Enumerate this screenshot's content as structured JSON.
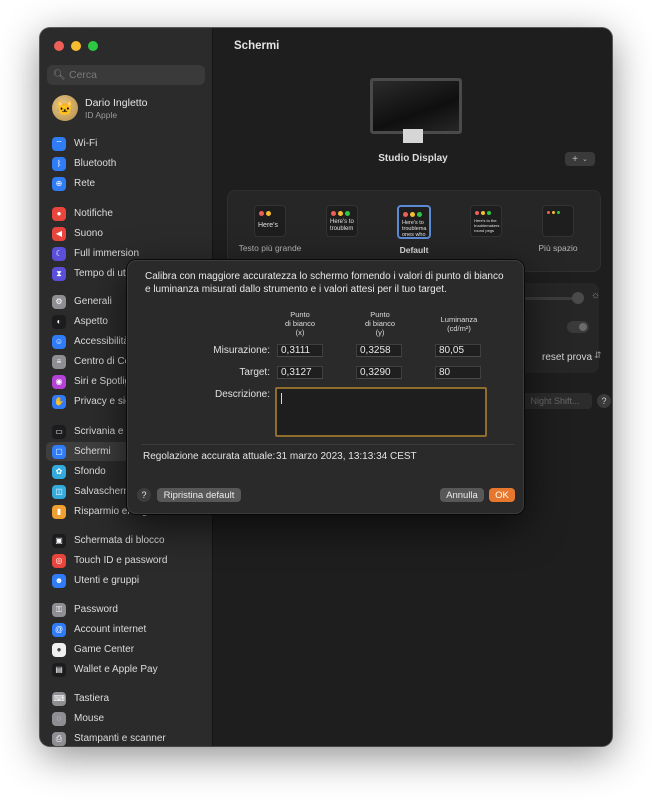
{
  "window": {
    "title": "Schermi",
    "traffic_colors": [
      "#ee5f57",
      "#f6bd2f",
      "#2dc842"
    ]
  },
  "sidebar": {
    "search_placeholder": "Cerca",
    "account": {
      "name": "Dario Ingletto",
      "subtitle": "ID Apple"
    },
    "items": [
      {
        "label": "Wi-Fi",
        "icon": "wifi-icon",
        "color": "#2f7cf6"
      },
      {
        "label": "Bluetooth",
        "icon": "bluetooth-icon",
        "color": "#2f7cf6"
      },
      {
        "label": "Rete",
        "icon": "globe-icon",
        "color": "#2f7cf6"
      },
      {
        "label": "Notifiche",
        "icon": "bell-icon",
        "color": "#e8453c"
      },
      {
        "label": "Suono",
        "icon": "speaker-icon",
        "color": "#e8453c"
      },
      {
        "label": "Full immersion",
        "icon": "moon-icon",
        "color": "#5b4fd9"
      },
      {
        "label": "Tempo di utilizzo",
        "icon": "hourglass-icon",
        "color": "#5b4fd9"
      },
      {
        "label": "Generali",
        "icon": "gear-icon",
        "color": "#8e8e93"
      },
      {
        "label": "Aspetto",
        "icon": "appearance-icon",
        "color": "#1c1c1e"
      },
      {
        "label": "Accessibilità",
        "icon": "accessibility-icon",
        "color": "#2f7cf6"
      },
      {
        "label": "Centro di Controllo",
        "icon": "control-center-icon",
        "color": "#8e8e93"
      },
      {
        "label": "Siri e Spotlight",
        "icon": "siri-icon",
        "color": "#b542d6"
      },
      {
        "label": "Privacy e sicurezza",
        "icon": "hand-icon",
        "color": "#2f7cf6"
      },
      {
        "label": "Scrivania e Dock",
        "icon": "dock-icon",
        "color": "#1c1c1e"
      },
      {
        "label": "Schermi",
        "icon": "display-icon",
        "color": "#2f7cf6"
      },
      {
        "label": "Sfondo",
        "icon": "wallpaper-icon",
        "color": "#34aadc"
      },
      {
        "label": "Salvaschermo",
        "icon": "screensaver-icon",
        "color": "#34aadc"
      },
      {
        "label": "Risparmio energia",
        "icon": "battery-icon",
        "color": "#f0a030"
      },
      {
        "label": "Schermata di blocco",
        "icon": "lock-screen-icon",
        "color": "#1c1c1e"
      },
      {
        "label": "Touch ID e password",
        "icon": "fingerprint-icon",
        "color": "#e8453c"
      },
      {
        "label": "Utenti e gruppi",
        "icon": "users-icon",
        "color": "#2f7cf6"
      },
      {
        "label": "Password",
        "icon": "key-icon",
        "color": "#8e8e93"
      },
      {
        "label": "Account internet",
        "icon": "at-icon",
        "color": "#2f7cf6"
      },
      {
        "label": "Game Center",
        "icon": "game-center-icon",
        "color": "#f0f0f0"
      },
      {
        "label": "Wallet e Apple Pay",
        "icon": "wallet-icon",
        "color": "#1c1c1e"
      },
      {
        "label": "Tastiera",
        "icon": "keyboard-icon",
        "color": "#8e8e93"
      },
      {
        "label": "Mouse",
        "icon": "mouse-icon",
        "color": "#8e8e93"
      },
      {
        "label": "Stampanti e scanner",
        "icon": "printer-icon",
        "color": "#8e8e93"
      }
    ]
  },
  "main": {
    "display_name": "Studio Display",
    "add_button": "+",
    "resolutions": [
      {
        "thumb": "Here's",
        "label": "Testo più grande"
      },
      {
        "thumb": "Here's to troublem",
        "label": ""
      },
      {
        "thumb": "Here's to troublema ones who",
        "label": "Default"
      },
      {
        "thumb": "Here's to the troublemakers round pegs",
        "label": ""
      },
      {
        "thumb": "",
        "label": "Più spazio"
      }
    ],
    "preset_label": "reset prova",
    "night_shift": "Night Shift..."
  },
  "dialog": {
    "message": "Calibra con maggiore accuratezza lo schermo fornendo i valori di punto di bianco e luminanza misurati dallo strumento e i valori attesi per il tuo target.",
    "headers": {
      "x": [
        "Punto",
        "di bianco",
        "(x)"
      ],
      "y": [
        "Punto",
        "di bianco",
        "(y)"
      ],
      "lum": [
        "Luminanza",
        "(cd/m²)"
      ]
    },
    "measure_label": "Misurazione:",
    "target_label": "Target:",
    "description_label": "Descrizione:",
    "measure": {
      "x": "0,3111",
      "y": "0,3258",
      "lum": "80,05"
    },
    "target": {
      "x": "0,3127",
      "y": "0,3290",
      "lum": "80"
    },
    "current_label": "Regolazione accurata attuale:",
    "current_value": "31 marzo 2023, 13:13:34 CEST",
    "reset_button": "Ripristina default",
    "cancel_button": "Annulla",
    "ok_button": "OK",
    "help": "?"
  }
}
